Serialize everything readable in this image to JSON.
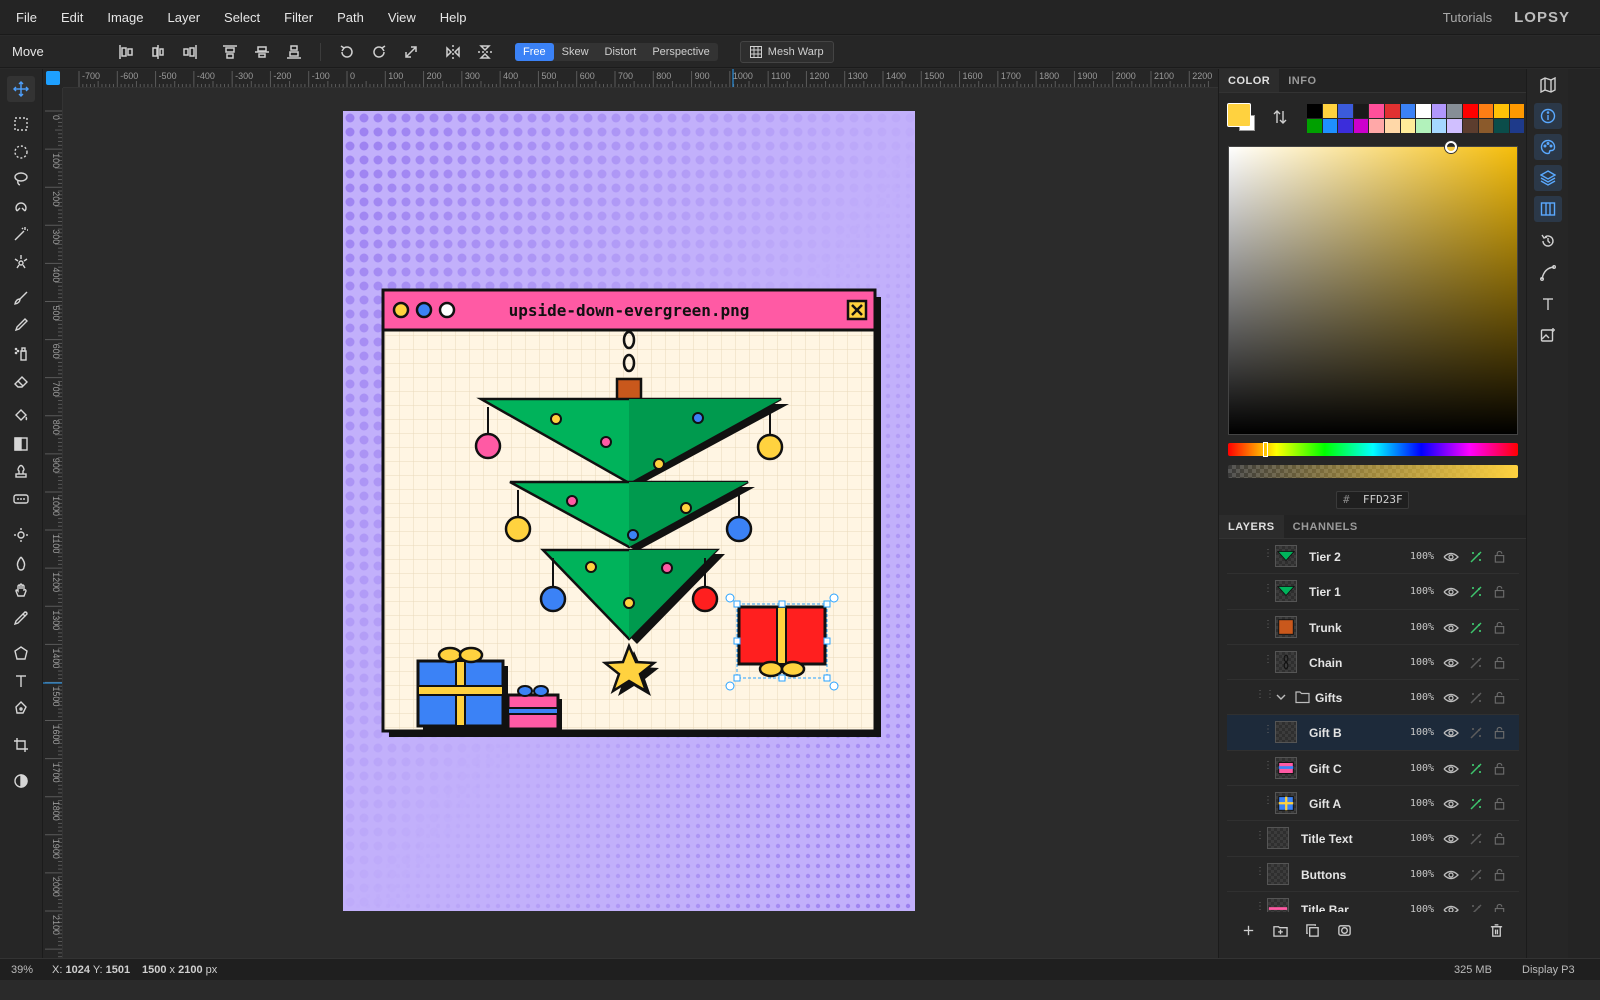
{
  "menu": [
    "File",
    "Edit",
    "Image",
    "Layer",
    "Select",
    "Filter",
    "Path",
    "View",
    "Help"
  ],
  "tutorials": "Tutorials",
  "logo": "LOPSY",
  "options": {
    "tool": "Move",
    "modes": [
      "Free",
      "Skew",
      "Distort",
      "Perspective"
    ],
    "active_mode": "Free",
    "mesh_warp": "Mesh Warp"
  },
  "ruler": {
    "top": [
      "-700",
      "-600",
      "-500",
      "-400",
      "-300",
      "-200",
      "-100",
      "0",
      "100",
      "200",
      "300",
      "400",
      "500",
      "600",
      "700",
      "800",
      "900",
      "1000",
      "1100",
      "1200",
      "1300",
      "1400",
      "1500",
      "1600",
      "1700",
      "1800",
      "1900",
      "2000",
      "2100",
      "2200"
    ],
    "left": [
      "0",
      "100",
      "200",
      "300",
      "400",
      "500",
      "600",
      "700",
      "800",
      "900",
      "1000",
      "1100",
      "1200",
      "1300",
      "1400",
      "1500",
      "1600",
      "1700",
      "1800",
      "1900",
      "2000",
      "2100"
    ]
  },
  "artwork": {
    "window_title": "upside-down-evergreen.png"
  },
  "color_panel": {
    "tabs": [
      "COLOR",
      "INFO"
    ],
    "active_tab": "COLOR",
    "hex_label": "#",
    "hex": "FFD23F",
    "foreground": "#FFD23F",
    "swatches": [
      "#000000",
      "#FFD23F",
      "#3B5BDB",
      "#1a1a1a",
      "#ff4f9a",
      "#e03131",
      "#3b82f6",
      "#ffffff",
      "#b197fc",
      "#868e96",
      "#ff0000",
      "#fd7e14",
      "#ffc107",
      "#ff9900",
      "#00a000",
      "#1e90ff",
      "#3b2ddb",
      "#cc00cc",
      "#ffa8a8",
      "#ffd8a8",
      "#ffec99",
      "#b2f2bb",
      "#a5d8ff",
      "#d0bfff",
      "#5c3d2e",
      "#8b5a2b",
      "#0b4d4a",
      "#1e3a8a"
    ]
  },
  "layers_panel": {
    "tabs": [
      "LAYERS",
      "CHANNELS"
    ],
    "active_tab": "LAYERS",
    "layers": [
      {
        "name": "Tier 2",
        "opacity": "100%",
        "fx": true,
        "thumb": "tier"
      },
      {
        "name": "Tier 1",
        "opacity": "100%",
        "fx": true,
        "thumb": "tier"
      },
      {
        "name": "Trunk",
        "opacity": "100%",
        "fx": true,
        "thumb": "trunk"
      },
      {
        "name": "Chain",
        "opacity": "100%",
        "fx": false,
        "thumb": "chain"
      },
      {
        "name": "Gifts",
        "opacity": "100%",
        "fx": false,
        "thumb": "folder"
      },
      {
        "name": "Gift B",
        "opacity": "100%",
        "fx": false,
        "thumb": "empty",
        "selected": true
      },
      {
        "name": "Gift C",
        "opacity": "100%",
        "fx": true,
        "thumb": "giftc"
      },
      {
        "name": "Gift A",
        "opacity": "100%",
        "fx": true,
        "thumb": "gifta"
      },
      {
        "name": "Title Text",
        "opacity": "100%",
        "fx": false,
        "thumb": "empty"
      },
      {
        "name": "Buttons",
        "opacity": "100%",
        "fx": false,
        "thumb": "empty"
      },
      {
        "name": "Title Bar",
        "opacity": "100%",
        "fx": false,
        "thumb": "titlebar"
      }
    ]
  },
  "status": {
    "zoom": "39%",
    "x_label": "X:",
    "x": "1024",
    "y_label": "Y:",
    "y": "1501",
    "size_w": "1500",
    "size_x": "x",
    "size_h": "2100",
    "size_unit": "px",
    "memory": "325 MB",
    "profile": "Display P3"
  }
}
